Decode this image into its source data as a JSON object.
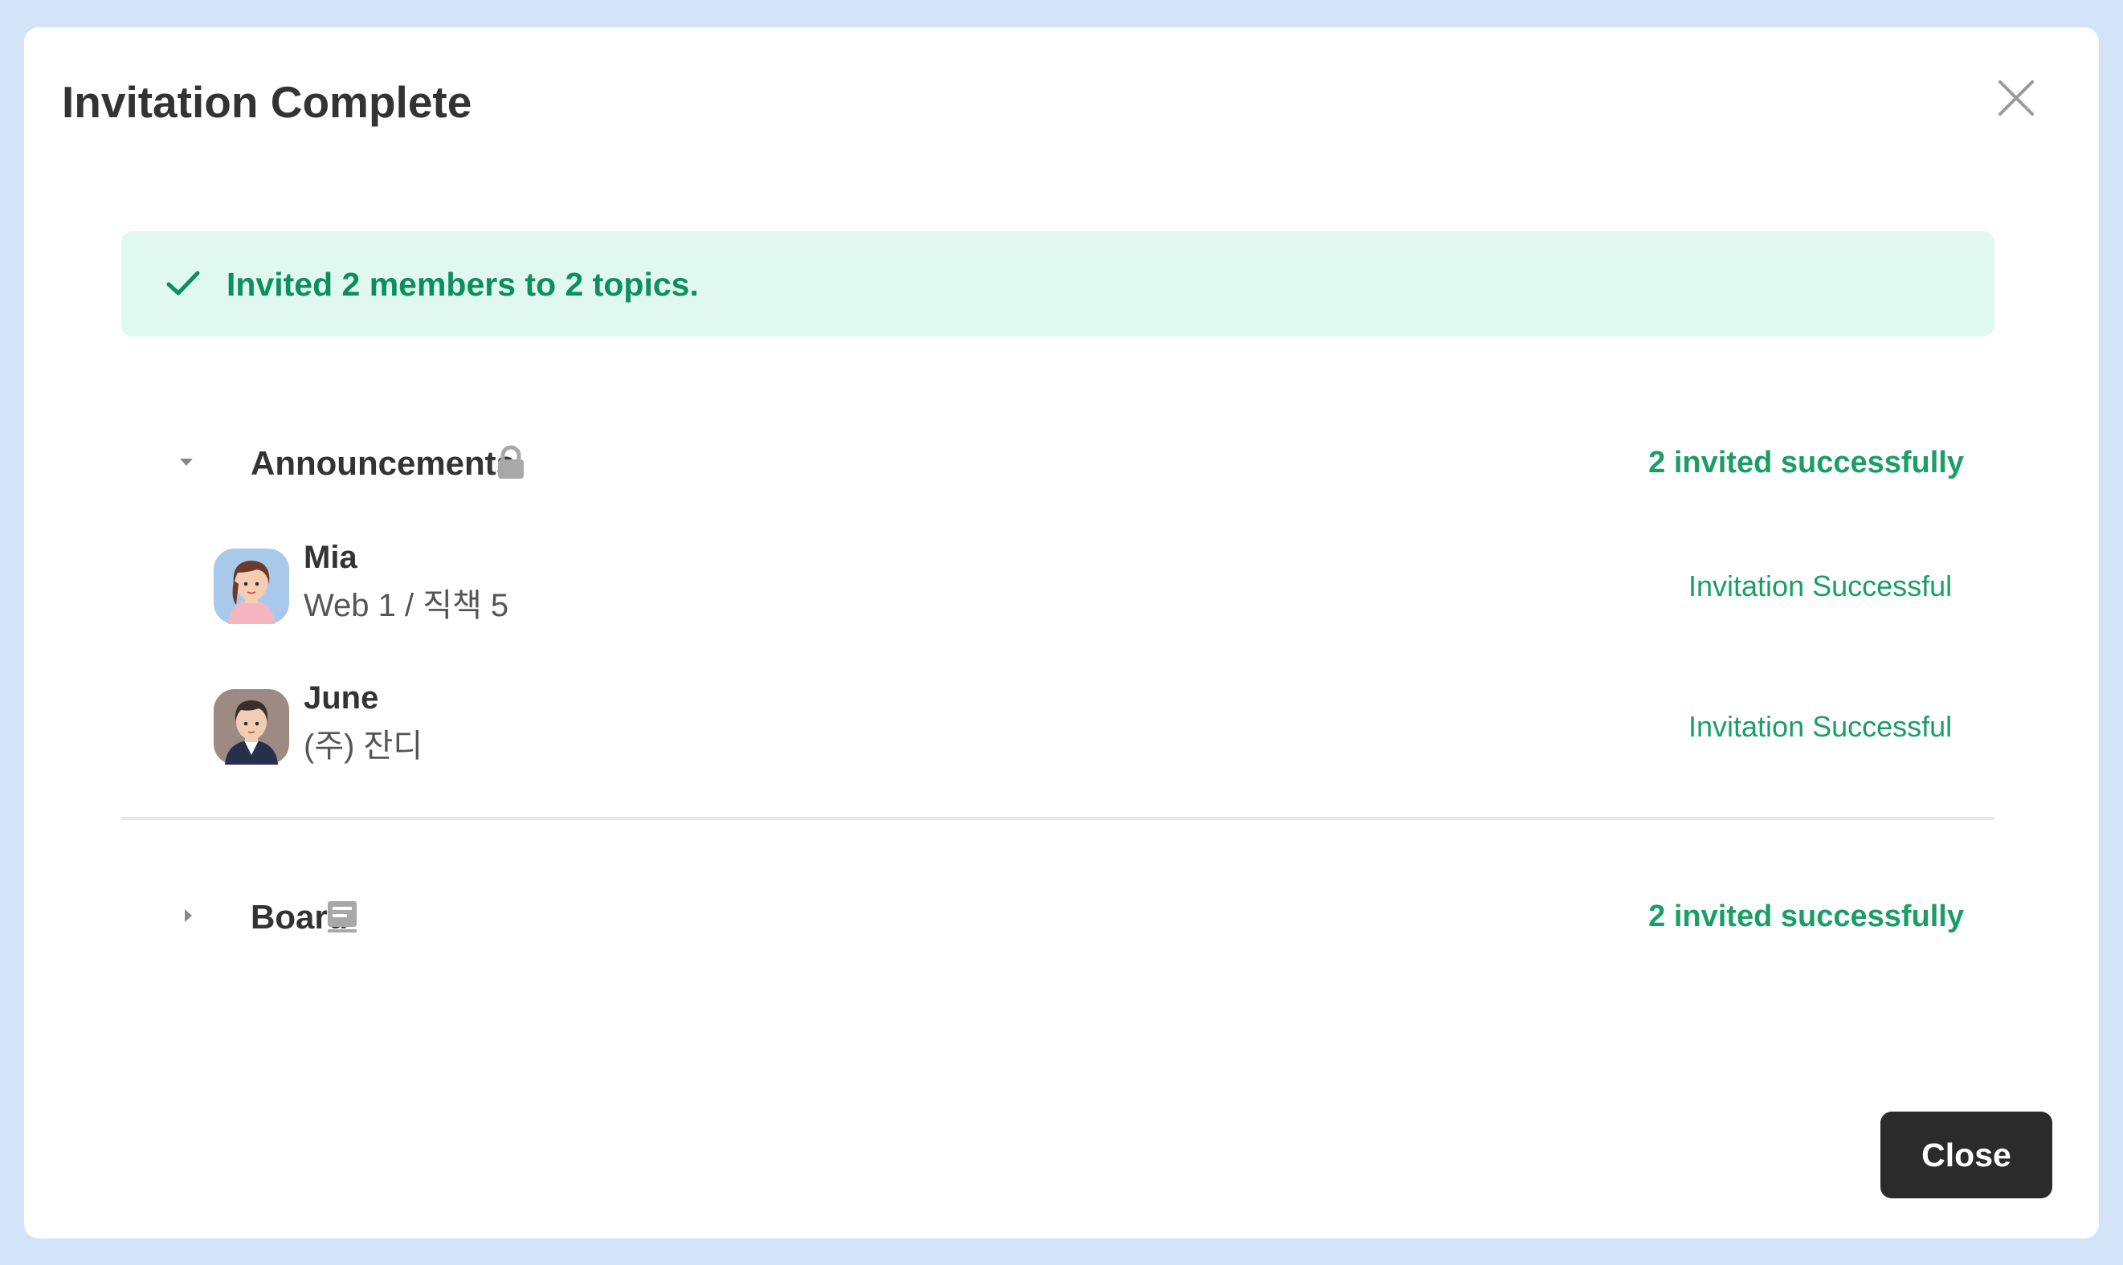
{
  "dialog": {
    "title": "Invitation Complete",
    "close_icon": "close-x-icon",
    "banner": {
      "icon": "check-icon",
      "text": "Invited 2 members to 2 topics."
    },
    "topics": [
      {
        "name": "Announcements",
        "icon": "lock-icon",
        "expanded": true,
        "summary": "2 invited successfully",
        "members": [
          {
            "name": "Mia",
            "org": "Web 1 / 직책 5",
            "status": "Invitation Successful"
          },
          {
            "name": "June",
            "org": "(주) 잔디",
            "status": "Invitation Successful"
          }
        ]
      },
      {
        "name": "Board",
        "icon": "board-icon",
        "expanded": false,
        "summary": "2 invited successfully"
      }
    ],
    "close_button_label": "Close"
  },
  "colors": {
    "backdrop": "#d3e4f8",
    "banner_bg": "#e0f8ef",
    "success_text": "#1a9e66",
    "button_bg": "#2b2b2b"
  }
}
